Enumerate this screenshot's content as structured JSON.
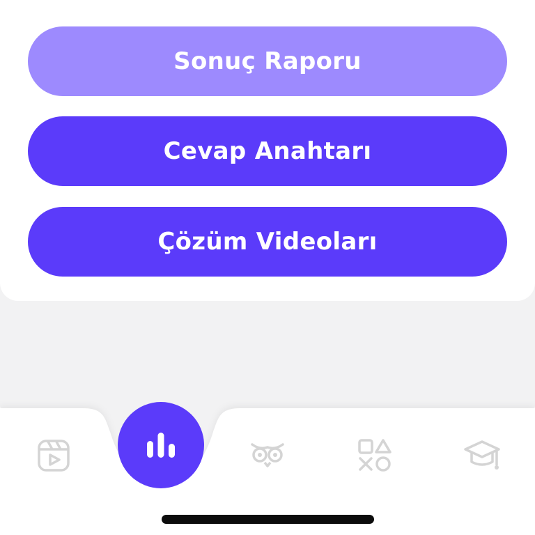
{
  "actions": {
    "result_report": "Sonuç Raporu",
    "answer_key": "Cevap Anahtarı",
    "solution_videos": "Çözüm Videoları"
  },
  "colors": {
    "primary": "#5b3bfa",
    "primary_light": "#9d8afe",
    "icon_inactive": "#d4d4d4",
    "background": "#f2f2f3"
  },
  "tabbar": {
    "items": [
      {
        "icon": "video-icon",
        "active": false
      },
      {
        "icon": "bar-chart-icon",
        "active": true
      },
      {
        "icon": "owl-icon",
        "active": false
      },
      {
        "icon": "game-shapes-icon",
        "active": false
      },
      {
        "icon": "graduation-cap-icon",
        "active": false
      }
    ]
  }
}
